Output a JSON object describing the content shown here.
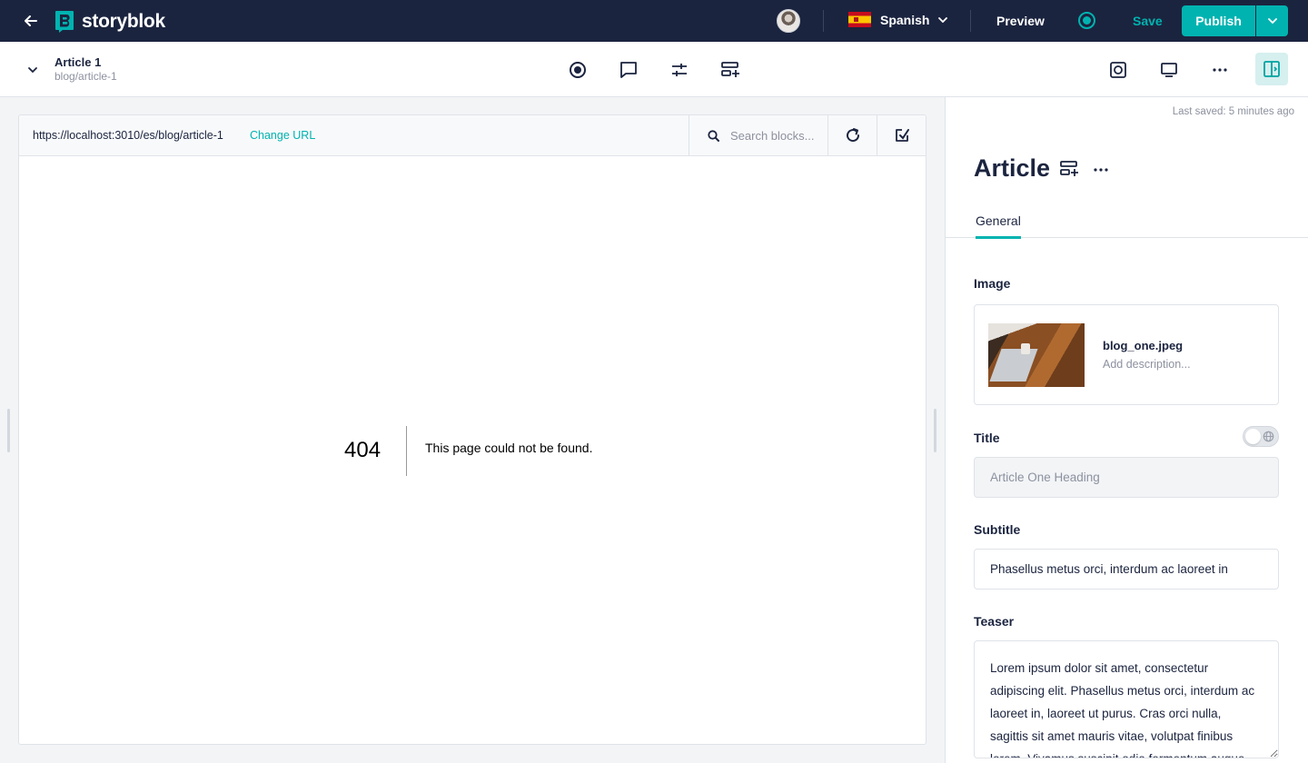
{
  "topbar": {
    "logo_text": "storyblok",
    "language": "Spanish",
    "preview_label": "Preview",
    "save_label": "Save",
    "publish_label": "Publish"
  },
  "story": {
    "name": "Article 1",
    "slug": "blog/article-1"
  },
  "preview": {
    "url": "https://localhost:3010/es/blog/article-1",
    "change_url_label": "Change URL",
    "search_placeholder": "Search blocks...",
    "error_code": "404",
    "error_message": "This page could not be found."
  },
  "panel": {
    "last_saved": "Last saved: 5 minutes ago",
    "title": "Article",
    "tabs": [
      {
        "label": "General"
      }
    ],
    "fields": {
      "image": {
        "label": "Image",
        "file_name": "blog_one.jpeg",
        "description_placeholder": "Add description..."
      },
      "title": {
        "label": "Title",
        "value": "Article One Heading"
      },
      "subtitle": {
        "label": "Subtitle",
        "value": "Phasellus metus orci, interdum ac laoreet in"
      },
      "teaser": {
        "label": "Teaser",
        "value": "Lorem ipsum dolor sit amet, consectetur adipiscing elit. Phasellus metus orci, interdum ac laoreet in, laoreet ut purus. Cras orci nulla, sagittis sit amet mauris vitae, volutpat finibus lorem. Vivamus suscipit odio fermentum augue"
      }
    }
  },
  "colors": {
    "topbar_bg": "#1b243f",
    "accent": "#00b3b0"
  },
  "icons": [
    "back-arrow-icon",
    "storyblok-logo-icon",
    "chevron-down-icon",
    "status-icon",
    "target-icon",
    "comment-icon",
    "sliders-icon",
    "add-block-icon",
    "preview-device-icon",
    "desktop-icon",
    "more-icon",
    "split-view-icon",
    "search-icon",
    "reload-icon",
    "select-element-icon",
    "globe-icon"
  ]
}
